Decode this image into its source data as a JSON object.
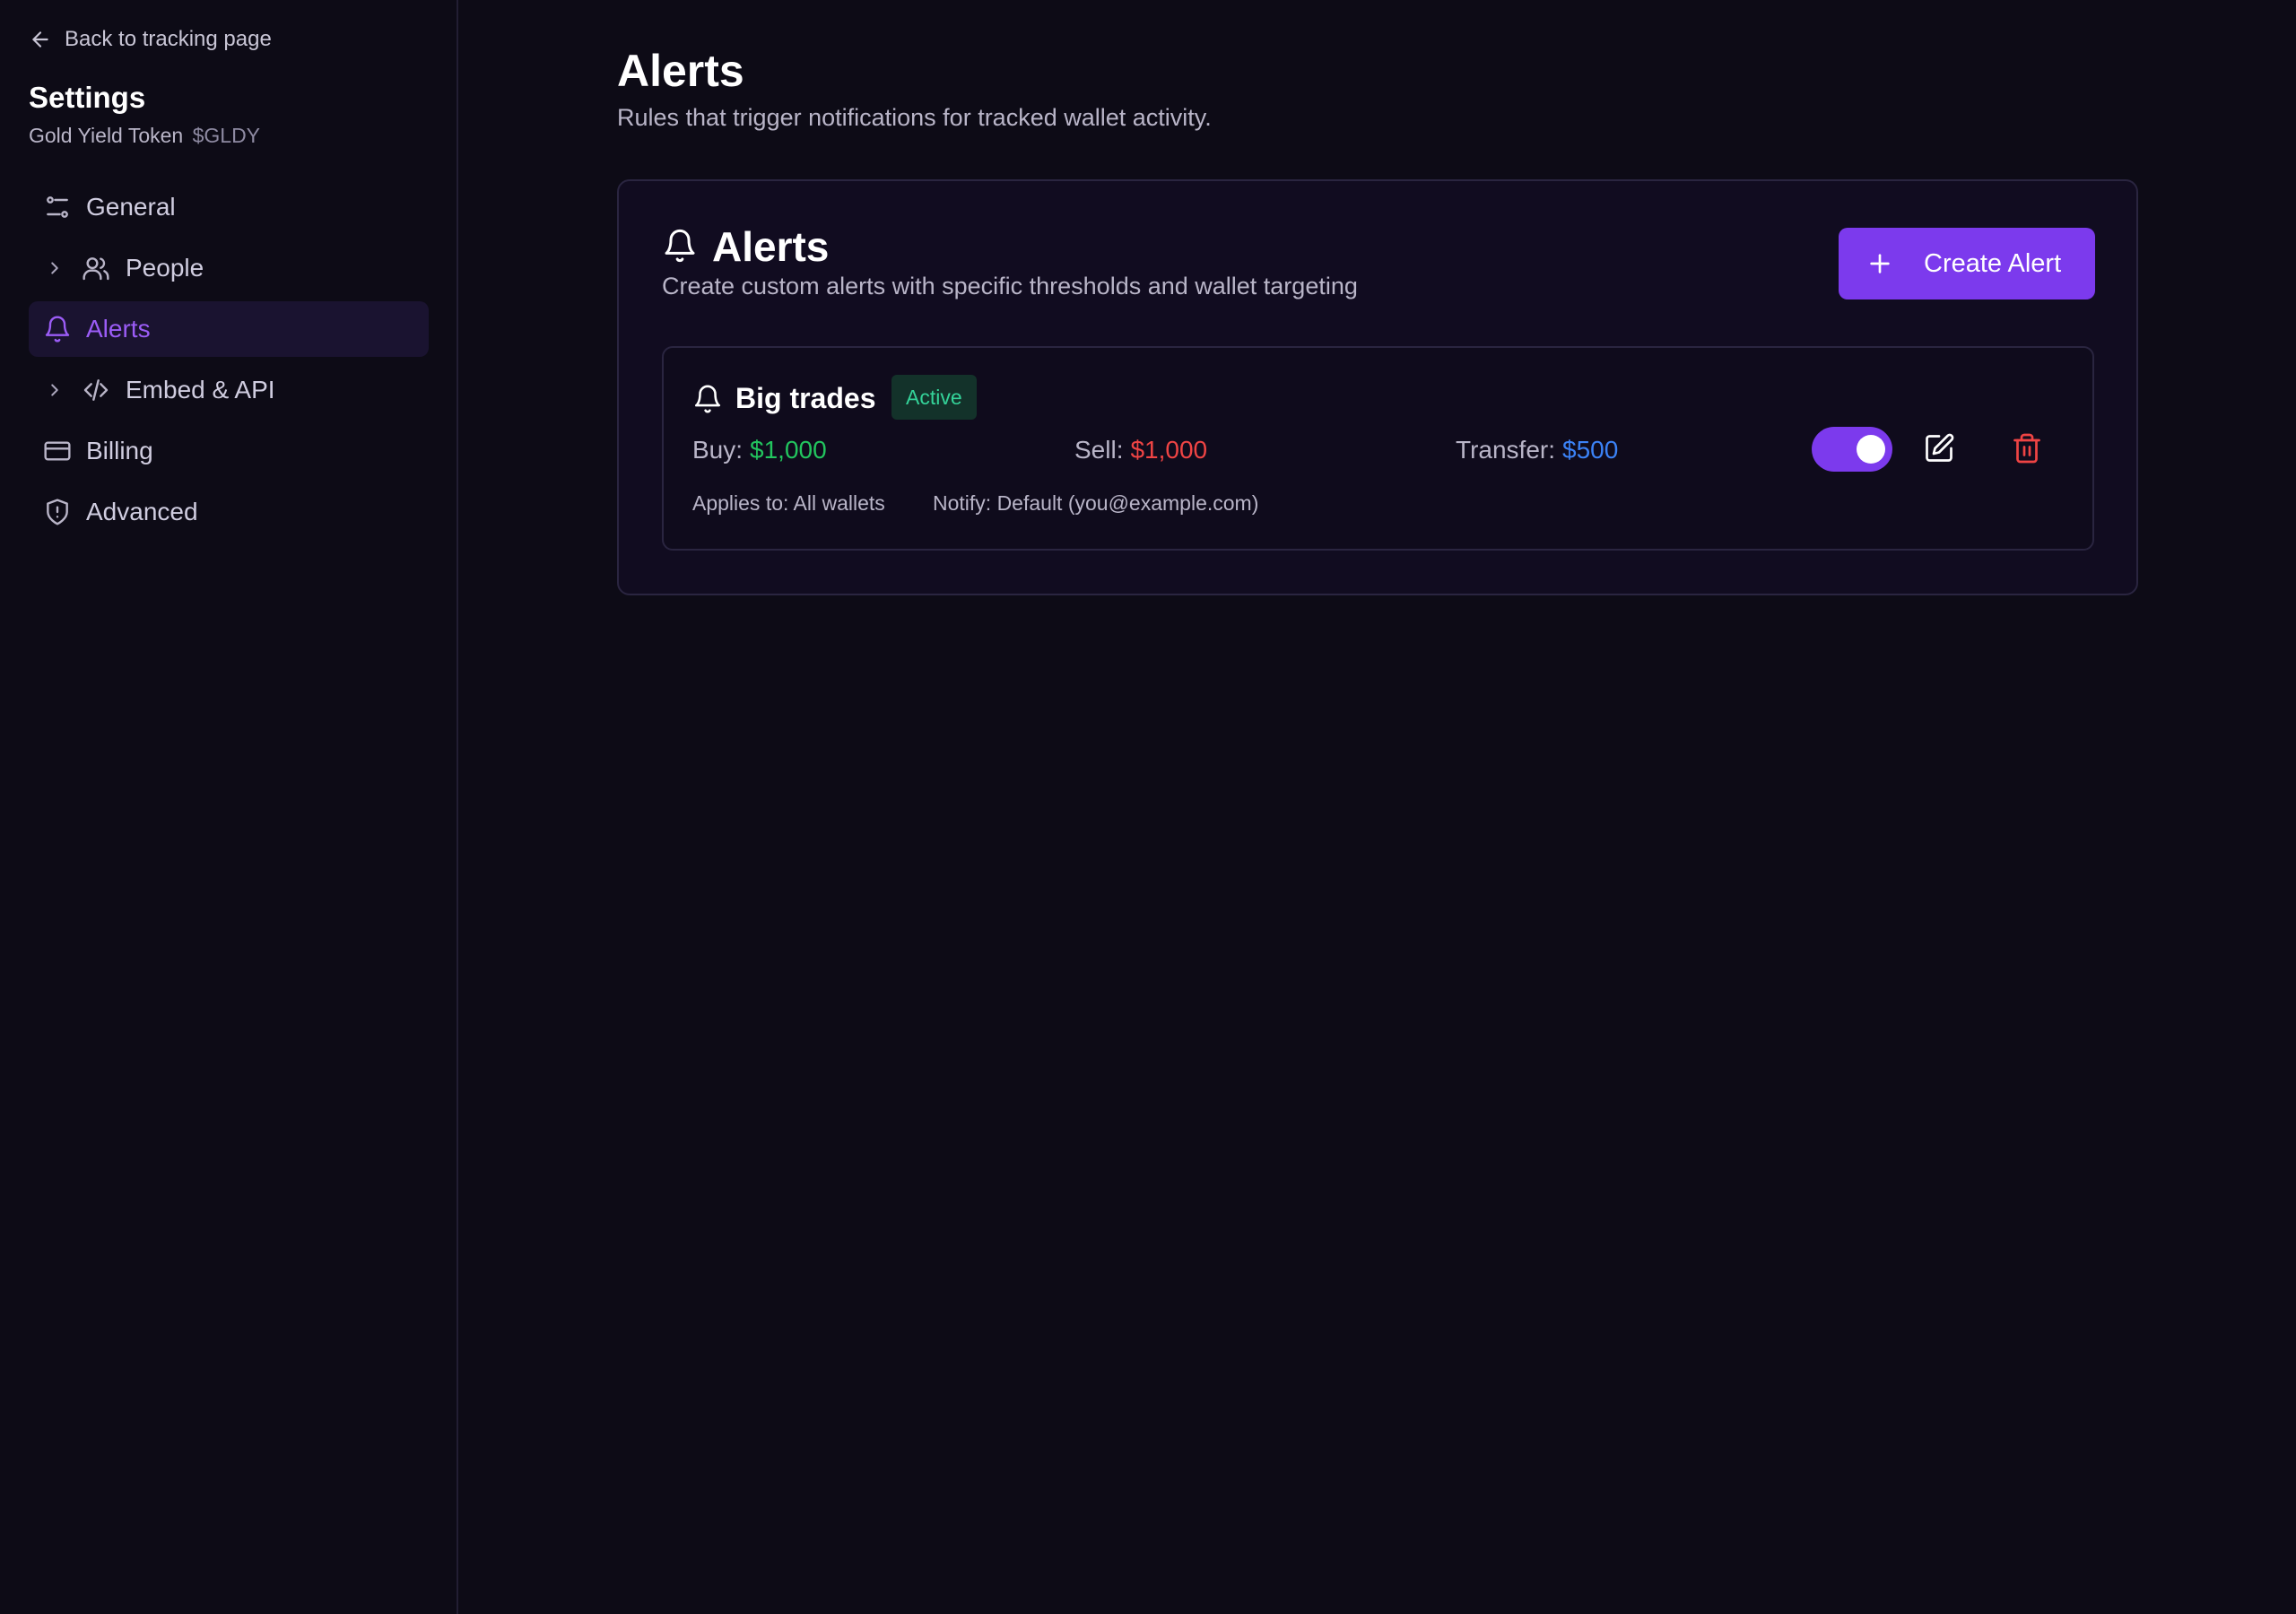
{
  "sidebar": {
    "back_label": "Back to tracking page",
    "title": "Settings",
    "project_name": "Gold Yield Token",
    "project_ticker": "$GLDY",
    "items": [
      {
        "label": "General",
        "icon": "sliders-icon",
        "expandable": false,
        "active": false
      },
      {
        "label": "People",
        "icon": "users-icon",
        "expandable": true,
        "active": false
      },
      {
        "label": "Alerts",
        "icon": "bell-icon",
        "expandable": false,
        "active": true
      },
      {
        "label": "Embed & API",
        "icon": "code-icon",
        "expandable": true,
        "active": false
      },
      {
        "label": "Billing",
        "icon": "credit-card-icon",
        "expandable": false,
        "active": false
      },
      {
        "label": "Advanced",
        "icon": "shield-alert-icon",
        "expandable": false,
        "active": false
      }
    ]
  },
  "main": {
    "title": "Alerts",
    "subtitle": "Rules that trigger notifications for tracked wallet activity.",
    "card": {
      "title": "Alerts",
      "description": "Create custom alerts with specific thresholds and wallet targeting",
      "create_button_label": "Create Alert",
      "alerts": [
        {
          "name": "Big trades",
          "status": "Active",
          "buy_label": "Buy:",
          "buy_value": "$1,000",
          "sell_label": "Sell:",
          "sell_value": "$1,000",
          "transfer_label": "Transfer:",
          "transfer_value": "$500",
          "applies_to": "Applies to: All wallets",
          "notify": "Notify: Default (you@example.com)",
          "enabled": true
        }
      ]
    }
  },
  "colors": {
    "accent": "#7c3aed",
    "active_nav": "#9b5cf6",
    "buy": "#22c55e",
    "sell": "#ef4444",
    "transfer": "#3b82f6",
    "status_active": "#34d399",
    "background": "#0d0b16"
  }
}
